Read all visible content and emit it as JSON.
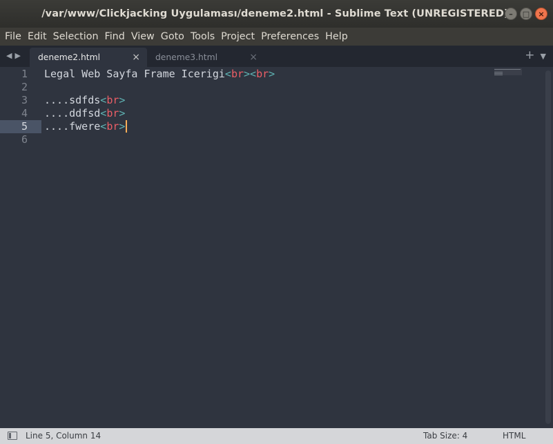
{
  "window": {
    "title": "/var/www/Clickjacking Uygulaması/deneme2.html - Sublime Text (UNREGISTERED)",
    "controls": [
      "minimize",
      "maximize",
      "close"
    ]
  },
  "menu": {
    "items": [
      "File",
      "Edit",
      "Selection",
      "Find",
      "View",
      "Goto",
      "Tools",
      "Project",
      "Preferences",
      "Help"
    ]
  },
  "tabs": [
    {
      "label": "deneme2.html",
      "active": true
    },
    {
      "label": "deneme3.html",
      "active": false
    }
  ],
  "editor": {
    "current_line": 5,
    "lines": [
      {
        "num": "1",
        "parts": [
          {
            "t": "text",
            "v": "Legal Web Sayfa Frame Icerigi"
          },
          {
            "t": "punct",
            "v": "<"
          },
          {
            "t": "tag",
            "v": "br"
          },
          {
            "t": "punct",
            "v": ">"
          },
          {
            "t": "punct",
            "v": "<"
          },
          {
            "t": "tag",
            "v": "br"
          },
          {
            "t": "punct",
            "v": ">"
          }
        ]
      },
      {
        "num": "2",
        "parts": []
      },
      {
        "num": "3",
        "parts": [
          {
            "t": "text",
            "v": "....sdfds"
          },
          {
            "t": "punct",
            "v": "<"
          },
          {
            "t": "tag",
            "v": "br"
          },
          {
            "t": "punct",
            "v": ">"
          }
        ]
      },
      {
        "num": "4",
        "parts": [
          {
            "t": "text",
            "v": "....ddfsd"
          },
          {
            "t": "punct",
            "v": "<"
          },
          {
            "t": "tag",
            "v": "br"
          },
          {
            "t": "punct",
            "v": ">"
          }
        ]
      },
      {
        "num": "5",
        "parts": [
          {
            "t": "text",
            "v": "....fwere"
          },
          {
            "t": "punct",
            "v": "<"
          },
          {
            "t": "tag",
            "v": "br"
          },
          {
            "t": "punct",
            "v": ">"
          }
        ]
      },
      {
        "num": "6",
        "parts": []
      }
    ]
  },
  "status": {
    "position": "Line 5, Column 14",
    "tab_size": "Tab Size: 4",
    "syntax": "HTML"
  },
  "colors": {
    "editor_bg": "#2f343f",
    "tag": "#ec5f67",
    "punct": "#5fb3b3",
    "text": "#d3d7de",
    "cursor": "#f9ae58"
  }
}
